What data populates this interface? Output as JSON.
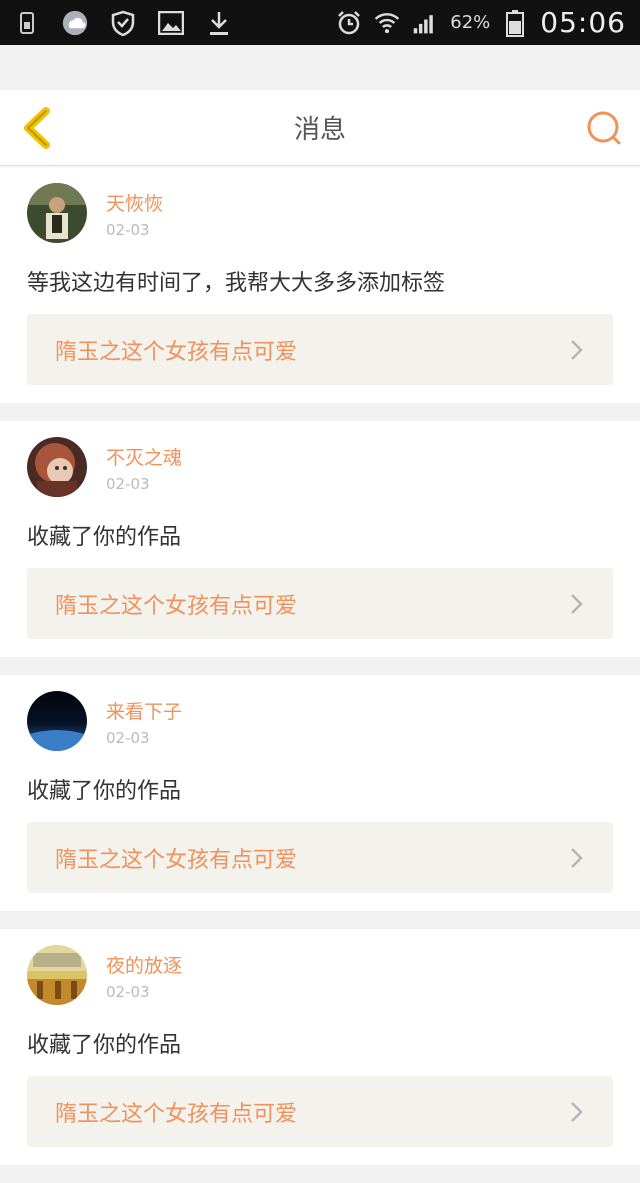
{
  "status_bar": {
    "battery_percent": "62%",
    "time": "05:06"
  },
  "header": {
    "title": "消息"
  },
  "messages": [
    {
      "username": "天恢恢",
      "date": "02-03",
      "text": "等我这边有时间了，我帮大大多多添加标签",
      "work_title": "隋玉之这个女孩有点可爱"
    },
    {
      "username": "不灭之魂",
      "date": "02-03",
      "text": "收藏了你的作品",
      "work_title": "隋玉之这个女孩有点可爱"
    },
    {
      "username": "来看下子",
      "date": "02-03",
      "text": "收藏了你的作品",
      "work_title": "隋玉之这个女孩有点可爱"
    },
    {
      "username": "夜的放逐",
      "date": "02-03",
      "text": "收藏了你的作品",
      "work_title": "隋玉之这个女孩有点可爱"
    }
  ],
  "colors": {
    "accent": "#f0925c",
    "back_icon": "#f2c200",
    "status_bar_bg": "#111111"
  },
  "icons": [
    "sim-icon",
    "weather-icon",
    "shield-icon",
    "gallery-icon",
    "download-icon",
    "alarm-icon",
    "wifi-icon",
    "signal-icon",
    "battery-icon",
    "back-icon",
    "search-icon",
    "chevron-right-icon"
  ]
}
